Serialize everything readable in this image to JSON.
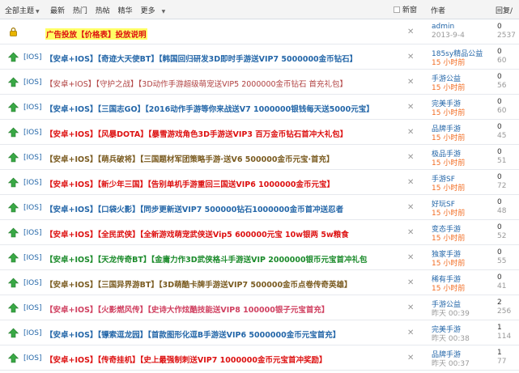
{
  "header": {
    "all_topics": "全部主题",
    "filters": [
      "最新",
      "热门",
      "热帖",
      "精华",
      "更多"
    ],
    "new_window": "新窗",
    "author": "作者",
    "reply_view": "回复/"
  },
  "ad": {
    "title": "广告投放【价格表】投放说明",
    "author": "admin",
    "time": "2013-9-4",
    "replies": "0",
    "views": "2537"
  },
  "rows": [
    {
      "tag": "[IOS]",
      "title": "【安卓+IOS】【奇迹大天使BT】【韩国回归研发3D即时手游送VIP7 5000000金币钻石】",
      "color": "c-blue",
      "author": "185sy精品公益",
      "time": "15 小时前",
      "replies": "0",
      "views": "60"
    },
    {
      "tag": "[IOS]",
      "title": "【安卓+IOS】【守护之战】【3D动作手游超级萌宠送VIP5 2000000金币钻石 首充礼包】",
      "color": "c-normal",
      "author": "手游公益",
      "time": "15 小时前",
      "replies": "0",
      "views": "56"
    },
    {
      "tag": "[IOS]",
      "title": "【安卓+IOS】【三国志GO】【2016动作手游等你来战送V7 1000000银钱每天送5000元宝】",
      "color": "c-blue",
      "author": "完美手游",
      "time": "15 小时前",
      "replies": "0",
      "views": "60"
    },
    {
      "tag": "[IOS]",
      "title": "【安卓+IOS】【风暴DOTA】【暴雪游戏角色3D手游送VIP3 百万金币钻石首冲大礼包】",
      "color": "c-red",
      "author": "品牌手游",
      "time": "15 小时前",
      "replies": "0",
      "views": "45"
    },
    {
      "tag": "[IOS]",
      "title": "【安卓+IOS】【萌兵破将】【三国题材军团策略手游·送V6 500000金币元宝·首充】",
      "color": "c-dark",
      "author": "极品手游",
      "time": "15 小时前",
      "replies": "0",
      "views": "51"
    },
    {
      "tag": "[IOS]",
      "title": "【安卓+IOS】【新少年三国】【告别单机手游重回三国送VIP6 1000000金币元宝】",
      "color": "c-red",
      "author": "手游SF",
      "time": "15 小时前",
      "replies": "0",
      "views": "72"
    },
    {
      "tag": "[IOS]",
      "title": "【安卓+IOS】【口袋火影】【同步更新送VIP7 500000钻石1000000金币首冲送忍者",
      "color": "c-blue",
      "author": "好玩SF",
      "time": "15 小时前",
      "replies": "0",
      "views": "48"
    },
    {
      "tag": "[IOS]",
      "title": "【安卓+IOS】【全民武侠】【全新游戏萌宠武侠送Vip5 600000元宝 10w银两 5w粮食",
      "color": "c-red",
      "author": "变态手游",
      "time": "15 小时前",
      "replies": "0",
      "views": "52"
    },
    {
      "tag": "[IOS]",
      "title": "【安卓+IOS】【天龙传奇BT】【金庸力作3D武侠格斗手游送VIP 2000000银币元宝首冲礼包",
      "color": "c-green",
      "author": "独家手游",
      "time": "15 小时前",
      "replies": "0",
      "views": "55"
    },
    {
      "tag": "[IOS]",
      "title": "【安卓+IOS】【三国异界游BT】【3D萌酷卡牌手游送VIP7 500000金币点卷传奇英雄】",
      "color": "c-dark",
      "author": "稀有手游",
      "time": "15 小时前",
      "replies": "0",
      "views": "41"
    },
    {
      "tag": "[IOS]",
      "title": "【安卓+IOS】【火影燃风传】【史诗大作炫酷技能送VIP8 100000银子元宝首充】",
      "color": "c-pink",
      "author": "手游公益",
      "time": "昨天 00:39",
      "time_gray": true,
      "replies": "2",
      "views": "256"
    },
    {
      "tag": "[IOS]",
      "title": "【安卓+IOS】【镖索逗龙园】【首款图形化逗B手游送VIP6 5000000金币元宝首充】",
      "color": "c-blue",
      "author": "完美手游",
      "time": "昨天 00:38",
      "time_gray": true,
      "replies": "1",
      "views": "114"
    },
    {
      "tag": "[IOS]",
      "title": "【安卓+IOS】【传奇挂机】【史上最强制刺送VIP7 1000000金币元宝首冲奖励】",
      "color": "c-red",
      "author": "品牌手游",
      "time": "昨天 00:37",
      "time_gray": true,
      "replies": "1",
      "views": "77"
    }
  ]
}
